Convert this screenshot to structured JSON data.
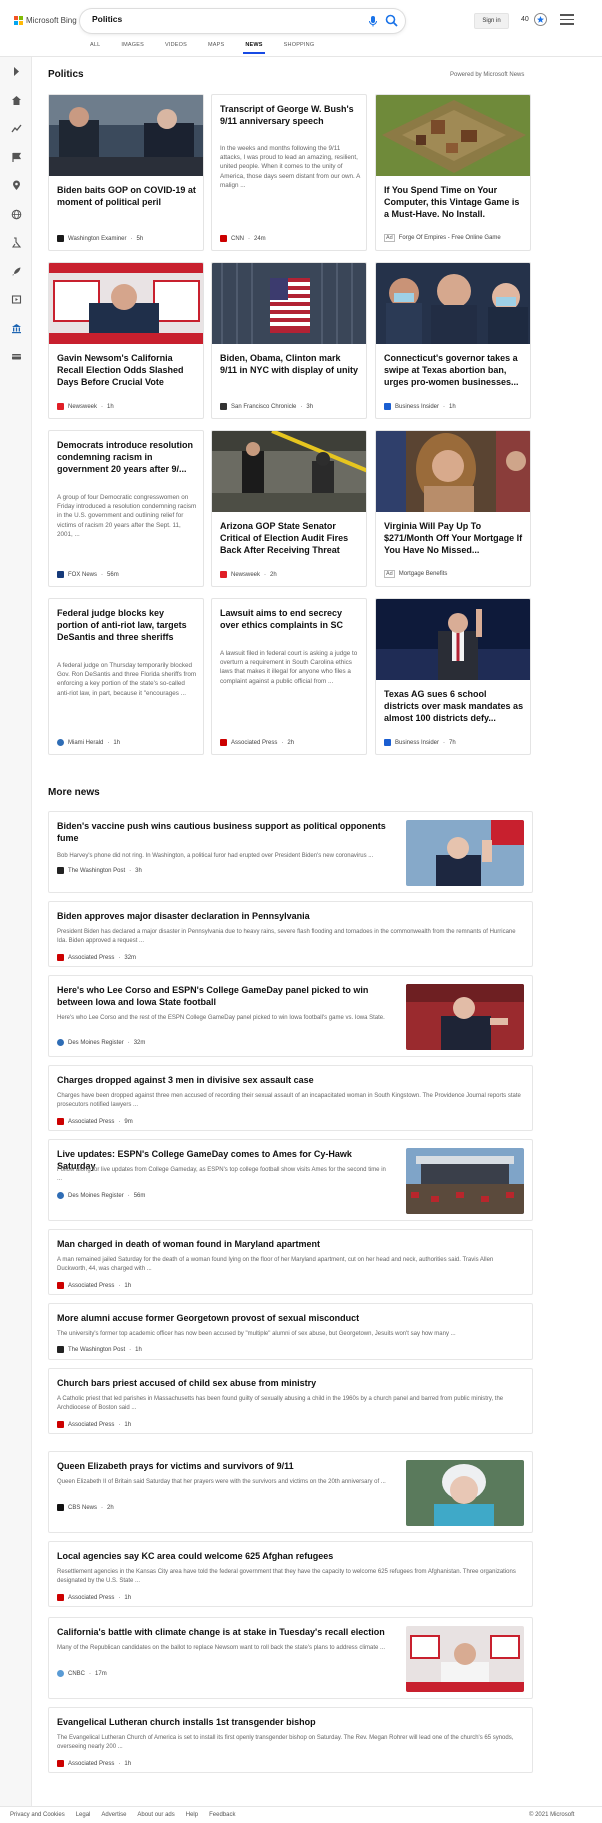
{
  "header": {
    "logo_text": "Microsoft Bing",
    "search_value": "Politics",
    "signin_label": "Sign in",
    "points": "40"
  },
  "tabs": [
    "ALL",
    "IMAGES",
    "VIDEOS",
    "MAPS",
    "NEWS",
    "SHOPPING"
  ],
  "active_tab": "NEWS",
  "sidebar_icons": [
    "collapse-icon",
    "home-icon",
    "trending-icon",
    "flag-icon",
    "location-icon",
    "globe-icon",
    "science-icon",
    "rocket-icon",
    "entertainment-icon",
    "politics-icon",
    "money-icon"
  ],
  "section": {
    "title": "Politics",
    "powered_by": "Powered by Microsoft News"
  },
  "cards": [
    {
      "title": "Biden baits GOP on COVID-19 at moment of political peril",
      "desc": "",
      "source": "Washington Examiner",
      "time": "5h",
      "ad": false,
      "source_color": "#1a1a1a"
    },
    {
      "title": "Transcript of George W. Bush's 9/11 anniversary speech",
      "desc": "In the weeks and months following the 9/11 attacks, I was proud to lead an amazing, resilient, united people. When it comes to the unity of America, those days seem distant from our own. A malign ...",
      "source": "CNN",
      "time": "24m",
      "ad": false,
      "source_color": "#cc0000"
    },
    {
      "title": "If You Spend Time on Your Computer, this Vintage Game is a Must-Have. No Install.",
      "desc": "",
      "source": "Forge Of Empires - Free Online Game",
      "time": "",
      "ad": true,
      "source_color": ""
    },
    {
      "title": "Gavin Newsom's California Recall Election Odds Slashed Days Before Crucial Vote",
      "desc": "",
      "source": "Newsweek",
      "time": "1h",
      "ad": false,
      "source_color": "#e01e26"
    },
    {
      "title": "Biden, Obama, Clinton mark 9/11 in NYC with display of unity",
      "desc": "",
      "source": "San Francisco Chronicle",
      "time": "3h",
      "ad": false,
      "source_color": "#333333"
    },
    {
      "title": "Connecticut's governor takes a swipe at Texas abortion ban, urges pro-women businesses...",
      "desc": "",
      "source": "Business Insider",
      "time": "1h",
      "ad": false,
      "source_color": "#1a5ed1"
    },
    {
      "title": "Democrats introduce resolution condemning racism in government 20 years after 9/...",
      "desc": "A group of four Democratic congresswomen on Friday introduced a resolution condemning racism in the U.S. government and outlining relief for victims of racism 20 years after the Sept. 11, 2001, ...",
      "source": "FOX News",
      "time": "56m",
      "ad": false,
      "source_color": "#163a7a"
    },
    {
      "title": "Arizona GOP State Senator Critical of Election Audit Fires Back After Receiving Threat",
      "desc": "",
      "source": "Newsweek",
      "time": "2h",
      "ad": false,
      "source_color": "#e01e26"
    },
    {
      "title": "Virginia Will Pay Up To $271/Month Off Your Mortgage If You Have No Missed...",
      "desc": "",
      "source": "Mortgage Benefits",
      "time": "",
      "ad": true,
      "source_color": ""
    },
    {
      "title": "Federal judge blocks key portion of anti-riot law, targets DeSantis and three sheriffs",
      "desc": "A federal judge on Thursday temporarily blocked Gov. Ron DeSantis and three Florida sheriffs from enforcing a key portion of the state's so-called anti-riot law, in part, because it \"encourages ...",
      "source": "Miami Herald",
      "time": "1h",
      "ad": false,
      "source_color": "#2f6db5"
    },
    {
      "title": "Lawsuit aims to end secrecy over ethics complaints in SC",
      "desc": "A lawsuit filed in federal court is asking a judge to overturn a requirement in South Carolina ethics laws that makes it illegal for anyone who files a complaint against a public official from ...",
      "source": "Associated Press",
      "time": "2h",
      "ad": false,
      "source_color": "#cc0000"
    },
    {
      "title": "Texas AG sues 6 school districts over mask mandates as almost 100 districts defy...",
      "desc": "",
      "source": "Business Insider",
      "time": "7h",
      "ad": false,
      "source_color": "#1a5ed1"
    }
  ],
  "more_news": {
    "title": "More news",
    "items": [
      {
        "title": "Biden's vaccine push wins cautious business support as political opponents fume",
        "desc": "Bob Harvey's phone did not ring. In Washington, a political furor had erupted over President Biden's new coronavirus ...",
        "source": "The Washington Post",
        "time": "3h",
        "source_color": "#222222",
        "has_image": true
      },
      {
        "title": "Biden approves major disaster declaration in Pennsylvania",
        "desc": "President Biden has declared a major disaster in Pennsylvania due to heavy rains, severe flash flooding and tornadoes in the commonwealth from the remnants of Hurricane Ida. Biden approved a request ...",
        "source": "Associated Press",
        "time": "32m",
        "source_color": "#cc0000",
        "has_image": false
      },
      {
        "title": "Here's who Lee Corso and ESPN's College GameDay panel picked to win between Iowa and Iowa State football",
        "desc": "Here's who Lee Corso and the rest of the ESPN College GameDay panel picked to win Iowa football's game vs. Iowa State.",
        "source": "Des Moines Register",
        "time": "32m",
        "source_color": "#2f6db5",
        "has_image": true
      },
      {
        "title": "Charges dropped against 3 men in divisive sex assault case",
        "desc": "Charges have been dropped against three men accused of recording their sexual assault of an incapacitated woman in South Kingstown. The Providence Journal reports state prosecutors notified lawyers ...",
        "source": "Associated Press",
        "time": "9m",
        "source_color": "#cc0000",
        "has_image": false
      },
      {
        "title": "Live updates: ESPN's College GameDay comes to Ames for Cy-Hawk Saturday",
        "desc": "Follow along for live updates from College Gameday, as ESPN's top college football show visits Ames for the second time in ...",
        "source": "Des Moines Register",
        "time": "56m",
        "source_color": "#2f6db5",
        "has_image": true
      },
      {
        "title": "Man charged in death of woman found in Maryland apartment",
        "desc": "A man remained jailed Saturday for the death of a woman found lying on the floor of her Maryland apartment, cut on her head and neck, authorities said. Travis Allen Duckworth, 44, was charged with ...",
        "source": "Associated Press",
        "time": "1h",
        "source_color": "#cc0000",
        "has_image": false
      },
      {
        "title": "More alumni accuse former Georgetown provost of sexual misconduct",
        "desc": "The university's former top academic officer has now been accused by \"multiple\" alumni of sex abuse, but Georgetown, Jesuits won't say how many ...",
        "source": "The Washington Post",
        "time": "1h",
        "source_color": "#222222",
        "has_image": false
      },
      {
        "title": "Church bars priest accused of child sex abuse from ministry",
        "desc": "A Catholic priest that led parishes in Massachusetts has been found guilty of sexually abusing a child in the 1960s by a church panel and barred from public ministry, the Archdiocese of Boston said ...",
        "source": "Associated Press",
        "time": "1h",
        "source_color": "#cc0000",
        "has_image": false
      },
      {
        "title": "Queen Elizabeth prays for victims and survivors of 9/11",
        "desc": "Queen Elizabeth II of Britain said Saturday that her prayers were with the survivors and victims on the 20th anniversary of ...",
        "source": "CBS News",
        "time": "2h",
        "source_color": "#111111",
        "has_image": true
      },
      {
        "title": "Local agencies say KC area could welcome 625 Afghan refugees",
        "desc": "Resettlement agencies in the Kansas City area have told the federal government that they have the capacity to welcome 625 refugees from Afghanistan. Three organizations designated by the U.S. State ...",
        "source": "Associated Press",
        "time": "1h",
        "source_color": "#cc0000",
        "has_image": false
      },
      {
        "title": "California's battle with climate change is at stake in Tuesday's recall election",
        "desc": "Many of the Republican candidates on the ballot to replace Newsom want to roll back the state's plans to address climate ...",
        "source": "CNBC",
        "time": "17m",
        "source_color": "#5a9bd5",
        "has_image": true
      },
      {
        "title": "Evangelical Lutheran church installs 1st transgender bishop",
        "desc": "The Evangelical Lutheran Church of America is set to install its first openly transgender bishop on Saturday. The Rev. Megan Rohrer will lead one of the church's 65 synods, overseeing nearly 200 ...",
        "source": "Associated Press",
        "time": "1h",
        "source_color": "#cc0000",
        "has_image": false
      }
    ]
  },
  "footer": {
    "links": [
      "Privacy and Cookies",
      "Legal",
      "Advertise",
      "About our ads",
      "Help",
      "Feedback"
    ],
    "copyright": "© 2021 Microsoft"
  },
  "colors": {
    "accent": "#174ae4",
    "link_blue": "#1a73e8"
  }
}
